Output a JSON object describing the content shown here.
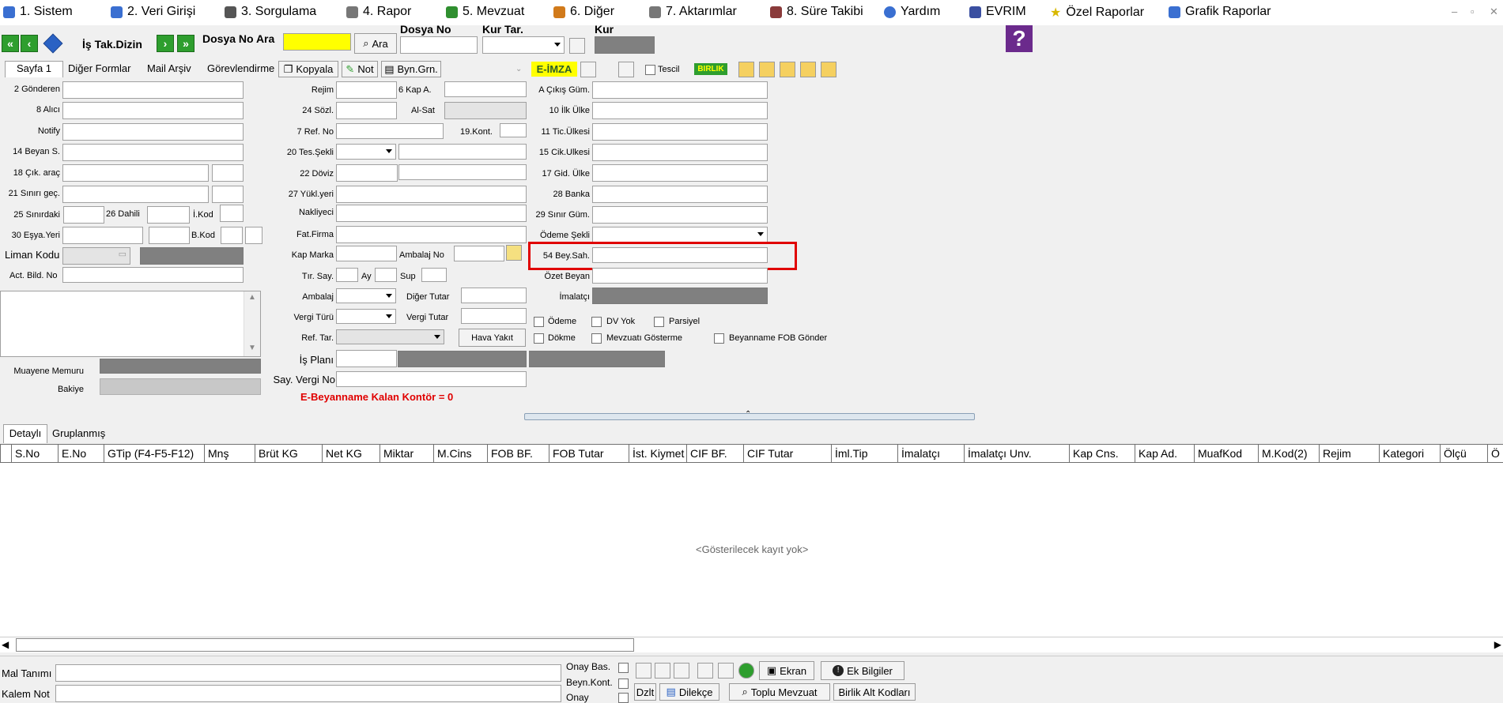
{
  "menu": [
    {
      "label": "1.  Sistem",
      "icon": "system-icon",
      "color": "#3a6fd1"
    },
    {
      "label": "2.  Veri Girişi",
      "icon": "data-entry-icon",
      "color": "#3a6fd1"
    },
    {
      "label": "3.  Sorgulama",
      "icon": "query-icon",
      "color": "#555555"
    },
    {
      "label": "4.  Rapor",
      "icon": "printer-icon",
      "color": "#777777"
    },
    {
      "label": "5.  Mevzuat",
      "icon": "books-icon",
      "color": "#2f8f2f"
    },
    {
      "label": "6.  Diğer",
      "icon": "other-icon",
      "color": "#d17a1a"
    },
    {
      "label": "7.  Aktarımlar",
      "icon": "transfer-icon",
      "color": "#777777"
    },
    {
      "label": "8. Süre Takibi",
      "icon": "clock-icon",
      "color": "#8a3a3a"
    },
    {
      "label": "Yardım",
      "icon": "help-icon",
      "color": "#3a6fd1"
    },
    {
      "label": "EVRIM",
      "icon": "evrim-icon",
      "color": "#3a4fa1"
    },
    {
      "label": "Özel Raporlar",
      "icon": "star-icon",
      "color": "#e0c020"
    },
    {
      "label": "Grafik Raporlar",
      "icon": "chart-icon",
      "color": "#3a6fd1"
    }
  ],
  "window": {
    "minimize": "–",
    "restore": "▫",
    "close": "✕"
  },
  "toolbar": {
    "dir_label": "İş Tak.Dizin",
    "dosya_ara_label": "Dosya No Ara",
    "search_button": "Ara",
    "dosya_no_label": "Dosya No",
    "kur_tar_label": "Kur Tar.",
    "kur_label": "Kur",
    "help_glyph": "?"
  },
  "tabs": {
    "sayfa1": "Sayfa 1",
    "diger_formlar": "Diğer Formlar",
    "mail_arsiv": "Mail Arşiv",
    "gorevlendirme": "Görevlendirme",
    "kopyala": "Kopyala",
    "not": "Not",
    "byn_grn": "Byn.Grn.",
    "e_imza": "E-İMZA",
    "tescil": "Tescil",
    "birlik": "BIRLIK"
  },
  "col1": {
    "gonderen": "2 Gönderen",
    "alici": "8 Alıcı",
    "notify": "Notify",
    "beyan_s": "14 Beyan S.",
    "cik_arac": "18 Çık. araç",
    "sinir_gec": "21 Sınırı geç.",
    "sinirdaki": "25 Sınırdaki",
    "dahili": "26 Dahili",
    "ikod": "İ.Kod",
    "esya_yeri": "30 Eşya.Yeri",
    "bkod": "B.Kod",
    "liman_kodu": "Liman Kodu",
    "act_bild_no": "Act. Bild. No",
    "muayene_memuru": "Muayene Memuru",
    "bakiye": "Bakiye"
  },
  "col2": {
    "rejim": "Rejim",
    "kap_a": "6 Kap A.",
    "sozl": "24 Sözl.",
    "al_sat": "Al-Sat",
    "ref_no": "7 Ref. No",
    "kont": "19.Kont.",
    "tes_sekli": "20 Tes.Şekli",
    "doviz": "22 Döviz",
    "yuk_yeri": "27 Yükl.yeri",
    "nakliyeci": "Nakliyeci",
    "fat_firma": "Fat.Firma",
    "kap_marka": "Kap Marka",
    "ambalaj_no": "Ambalaj No",
    "tir_say": "Tır. Say.",
    "ay": "Ay",
    "sup": "Sup",
    "ambalaj": "Ambalaj",
    "diger_tutar": "Diğer Tutar",
    "vergi_turu": "Vergi Türü",
    "vergi_tutar": "Vergi Tutar",
    "ref_tar": "Ref. Tar.",
    "hava_yakit": "Hava Yakıt",
    "is_plani": "İş Planı",
    "say_vergi_no": "Say. Vergi No",
    "kontor": "E-Beyanname Kalan Kontör = 0"
  },
  "col3": {
    "cikis_gum": "A Çıkış Güm.",
    "ilk_ulke": "10 İlk Ülke",
    "tic_ulkesi": "11 Tic.Ülkesi",
    "cik_ulkesi": "15 Cik.Ulkesi",
    "gid_ulke": "17 Gid. Ülke",
    "banka": "28 Banka",
    "sinir_gum": "29 Sınır Güm.",
    "odeme_sekli": "Ödeme Şekli",
    "bey_sah": "54 Bey.Sah.",
    "ozet_beyan": "Özet Beyan",
    "imalatci": "İmalatçı",
    "odeme": "Ödeme",
    "dv_yok": "DV Yok",
    "parsiyel": "Parsiyel",
    "dokme": "Dökme",
    "mevzuati_gosterme": "Mevzuatı Gösterme",
    "fob_gonder": "Beyanname FOB Gönder"
  },
  "grid": {
    "tab_detayli": "Detaylı",
    "tab_gruplanmis": "Gruplanmış",
    "columns": [
      "S.No",
      "E.No",
      "GTip (F4-F5-F12)",
      "Mnş",
      "Brüt KG",
      "Net KG",
      "Miktar",
      "M.Cins",
      "FOB BF.",
      "FOB Tutar",
      "İst. Kiymet",
      "CIF BF.",
      "CIF Tutar",
      "İml.Tip",
      "İmalatçı",
      "İmalatçı Unv.",
      "Kap Cns.",
      "Kap Ad.",
      "MuafKod",
      "M.Kod(2)",
      "Rejim",
      "Kategori",
      "Ölçü",
      "Ö"
    ],
    "empty": "<Gösterilecek kayıt yok>"
  },
  "bottom": {
    "mal_tanimi": "Mal Tanımı",
    "kalem_not": "Kalem Not",
    "onay_bas": "Onay Bas.",
    "beyn_kont": "Beyn.Kont.",
    "onay": "Onay",
    "ekran": "Ekran",
    "ek_bilgiler": "Ek Bilgiler",
    "dzlt": "Dzlt",
    "dilekce": "Dilekçe",
    "toplu_mevzuat": "Toplu Mevzuat",
    "birlik_alt_kodlari": "Birlik Alt Kodları"
  },
  "colors": {
    "accent_yellow": "#ffff00",
    "highlight_red": "#e00000",
    "help_purple": "#6b2a8c",
    "kontor_red": "#e00000",
    "nav_green": "#2e9e2e"
  }
}
